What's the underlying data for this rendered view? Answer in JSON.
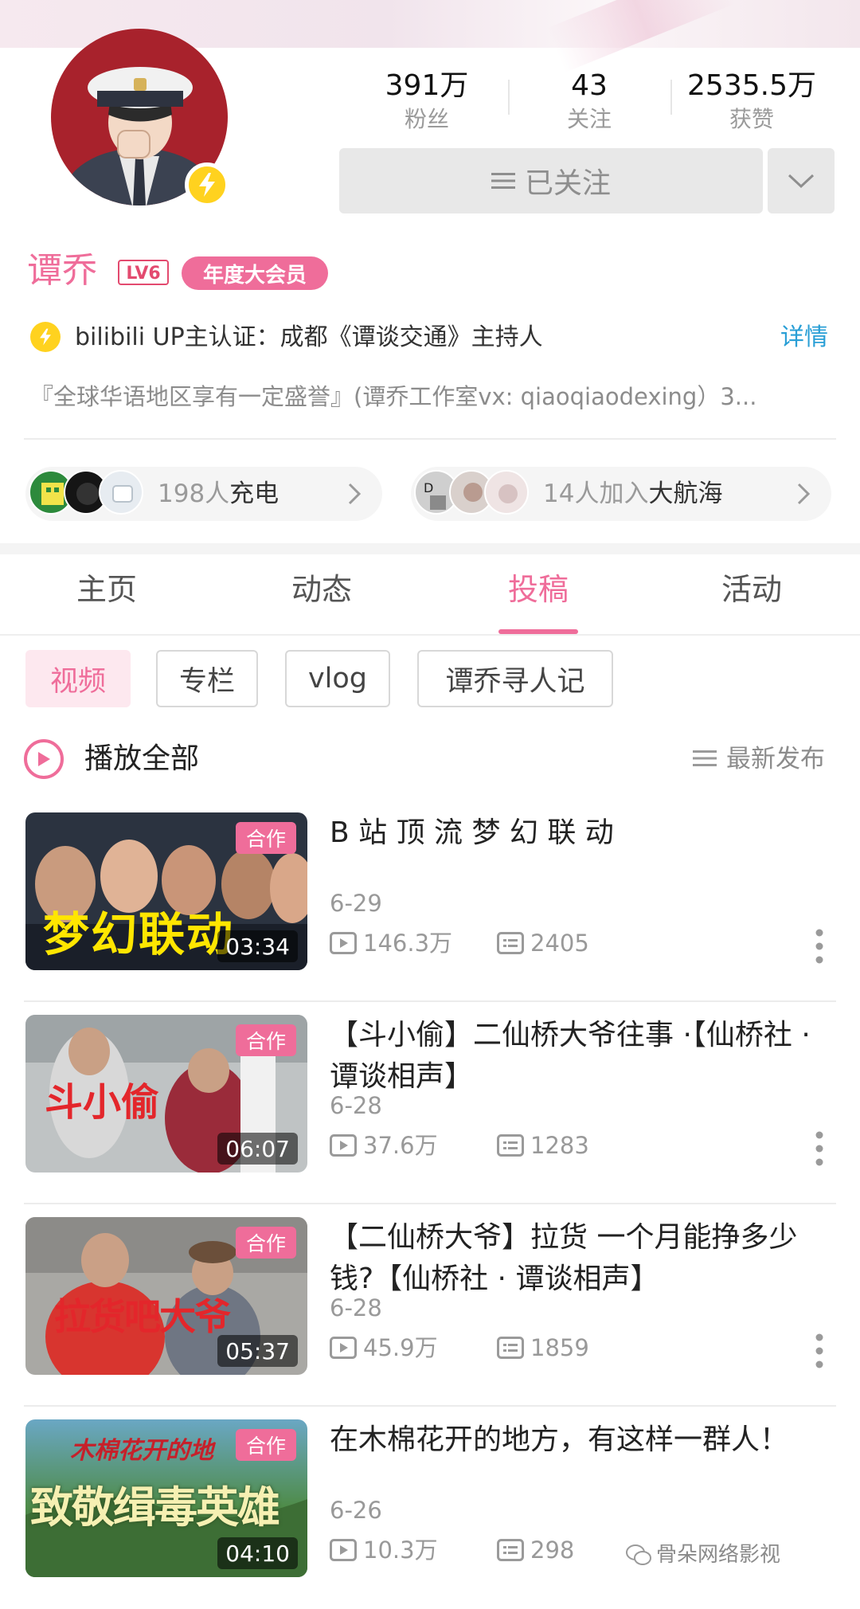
{
  "profile": {
    "name": "谭乔",
    "level": "LV6",
    "vip_badge": "年度大会员",
    "follow_button": "已关注",
    "stats": [
      {
        "value": "391万",
        "label": "粉丝"
      },
      {
        "value": "43",
        "label": "关注"
      },
      {
        "value": "2535.5万",
        "label": "获赞"
      }
    ],
    "verification": "bilibili UP主认证：成都《谭谈交通》主持人",
    "detail_link": "详情",
    "bio": "『全球华语地区享有一定盛誉』(谭乔工作室vx: qiaoqiaodexing）3..."
  },
  "supporters": {
    "charge_count": "198人",
    "charge_label": "充电",
    "fleet_count": "14人加入",
    "fleet_label": "大航海"
  },
  "tabs": [
    "主页",
    "动态",
    "投稿",
    "活动"
  ],
  "active_tab": "投稿",
  "filters": [
    "视频",
    "专栏",
    "vlog",
    "谭乔寻人记"
  ],
  "list_header": {
    "play_all": "播放全部",
    "sort": "最新发布"
  },
  "videos": [
    {
      "title": "B 站 顶 流 梦 幻 联 动",
      "date": "6-29",
      "plays": "146.3万",
      "danmaku": "2405",
      "duration": "03:34",
      "tag": "合作",
      "cover_text": "梦幻联动"
    },
    {
      "title": "【斗小偷】二仙桥大爷往事 ·【仙桥社 · 谭谈相声】",
      "date": "6-28",
      "plays": "37.6万",
      "danmaku": "1283",
      "duration": "06:07",
      "tag": "合作",
      "cover_text": "斗小偷"
    },
    {
      "title": "【二仙桥大爷】拉货  一个月能挣多少钱?【仙桥社 · 谭谈相声】",
      "date": "6-28",
      "plays": "45.9万",
      "danmaku": "1859",
      "duration": "05:37",
      "tag": "合作",
      "cover_text": "拉货吧大爷"
    },
    {
      "title": "在木棉花开的地方，有这样一群人！",
      "date": "6-26",
      "plays": "10.3万",
      "danmaku": "298",
      "duration": "04:10",
      "tag": "合作",
      "cover_text": "致敬缉毒英雄",
      "cover_text_top": "木棉花开的地"
    }
  ],
  "watermark": "骨朵网络影视",
  "colors": {
    "accent": "#ef6d9a",
    "link": "#2a9fd6",
    "bolt": "#ffd21f"
  }
}
